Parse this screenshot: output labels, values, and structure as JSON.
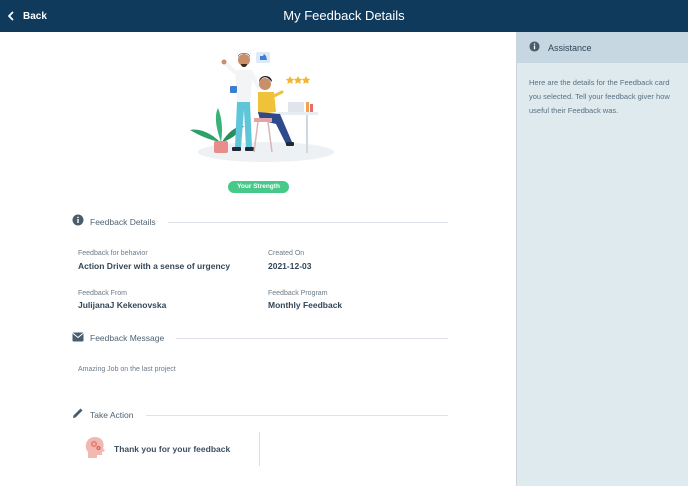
{
  "header": {
    "back_label": "Back",
    "title": "My Feedback Details",
    "background": "#103a5c"
  },
  "badge": {
    "label": "Your Strength",
    "color": "#47c98a"
  },
  "details": {
    "section_title": "Feedback Details",
    "behavior_label": "Feedback for behavior",
    "behavior_value": "Action Driver with a sense of urgency",
    "created_label": "Created On",
    "created_value": "2021-12-03",
    "from_label": "Feedback From",
    "from_value": "JulijanaJ Kekenovska",
    "program_label": "Feedback Program",
    "program_value": "Monthly Feedback"
  },
  "message": {
    "section_title": "Feedback Message",
    "text": "Amazing Job on the last project"
  },
  "action": {
    "section_title": "Take Action",
    "card_label": "Thank you for your feedback"
  },
  "assistance": {
    "title": "Assistance",
    "text": "Here are the details for the Feedback card you selected. Tell your feedback giver how useful their Feedback was."
  }
}
